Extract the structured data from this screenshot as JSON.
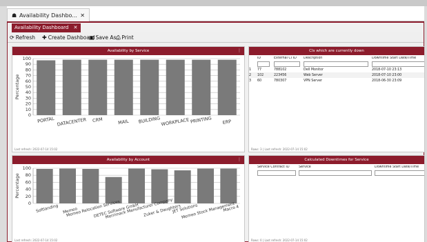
{
  "outer_tab": {
    "label": "Availability Dashbo...",
    "close": "✕"
  },
  "inner_tab": {
    "label": "Availability Dashboard",
    "close": "✕"
  },
  "toolbar": {
    "refresh": "Refresh",
    "create": "Create Dashboard",
    "save": "Save As...",
    "print": "Print"
  },
  "panels": {
    "service": {
      "title": "Availability by Service",
      "menu": "⋮",
      "footer": "Last refresh: 2022-07-14 15:02"
    },
    "cis": {
      "title": "CIs which are currently down",
      "footer": "Rows: 3 | Last refresh: 2022-07-14 15:02"
    },
    "account": {
      "title": "Availability by Account",
      "menu": "⋮",
      "footer": "Last refresh: 2022-07-14 15:02"
    },
    "downtimes": {
      "title": "Calculated Downtimes for Service",
      "footer": "Rows: 0 | Last refresh: 2022-07-14 15:02"
    }
  },
  "cis_table": {
    "headers": [
      "ID",
      "External CI ID",
      "Description",
      "Downtime Start Date/Time"
    ],
    "rows": [
      [
        "1",
        "77",
        "788102",
        "Dell Monitor",
        "2018-07-10 23:13"
      ],
      [
        "2",
        "102",
        "223456",
        "Web Server",
        "2018-07-10 23:00"
      ],
      [
        "3",
        "60",
        "780307",
        "VPN Server",
        "2018-06-30 23:09"
      ]
    ]
  },
  "downtimes_table": {
    "headers": [
      "Service Contract ID",
      "Service",
      "Downtime Start Date/Time"
    ]
  },
  "chart_data": [
    {
      "type": "bar",
      "title": "Availability by Service",
      "categories": [
        "PORTAL",
        "DATACENTER",
        "CRM",
        "MAIL",
        "BUILDING",
        "WORKPLACE",
        "PRINTING",
        "ERP"
      ],
      "values": [
        97,
        98,
        98,
        98,
        98,
        98,
        98,
        98
      ],
      "ylabel": "Percentage",
      "ylim": [
        0,
        100
      ],
      "yticks": [
        "0",
        "10",
        "20",
        "30",
        "40",
        "50",
        "60",
        "70",
        "80",
        "90",
        "100"
      ],
      "grid": true,
      "bar_color": "#7a7a7a"
    },
    {
      "type": "bar",
      "title": "Availability by Account",
      "categories": [
        "Softlanding",
        "Memeo",
        "Memeo Relocation Services",
        "DETEC Software GmbH",
        "Merrimack Manufacturer Company",
        "Zuker & Daughters",
        "JET Solutions",
        "Memeo Stock Management",
        "Macro 4"
      ],
      "values": [
        98,
        99,
        98,
        75,
        99,
        97,
        94,
        99,
        99
      ],
      "ylabel": "Percentage",
      "ylim": [
        0,
        100
      ],
      "yticks": [
        "0",
        "20",
        "40",
        "60",
        "80",
        "100"
      ],
      "grid": true,
      "bar_color": "#7a7a7a"
    }
  ],
  "colors": {
    "accent": "#8c1c2c",
    "bar": "#7a7a7a"
  }
}
